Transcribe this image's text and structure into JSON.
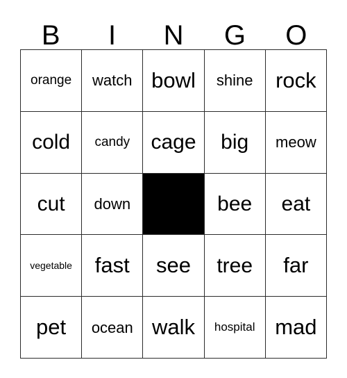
{
  "card": {
    "title": "BINGO",
    "header_letters": [
      "B",
      "I",
      "N",
      "G",
      "O"
    ],
    "free_space": {
      "row": 3,
      "column": 3,
      "color": "#000000",
      "label": ""
    },
    "colors": {
      "background": "#ffffff",
      "grid_line": "#2b2b2b",
      "text": "#000000",
      "free_space": "#000000"
    },
    "rows": [
      [
        {
          "word": "orange",
          "size": "sm"
        },
        {
          "word": "watch",
          "size": "md"
        },
        {
          "word": "bowl",
          "size": "xl"
        },
        {
          "word": "shine",
          "size": "md"
        },
        {
          "word": "rock",
          "size": "xl"
        }
      ],
      [
        {
          "word": "cold",
          "size": "lg"
        },
        {
          "word": "candy",
          "size": "sm"
        },
        {
          "word": "cage",
          "size": "lg"
        },
        {
          "word": "big",
          "size": "lg"
        },
        {
          "word": "meow",
          "size": "md"
        }
      ],
      [
        {
          "word": "cut",
          "size": "lg"
        },
        {
          "word": "down",
          "size": "md"
        },
        {
          "word": "",
          "size": "lg",
          "free": true
        },
        {
          "word": "bee",
          "size": "lg"
        },
        {
          "word": "eat",
          "size": "lg"
        }
      ],
      [
        {
          "word": "vegetable",
          "size": "xxs"
        },
        {
          "word": "fast",
          "size": "xl"
        },
        {
          "word": "see",
          "size": "xl"
        },
        {
          "word": "tree",
          "size": "lg"
        },
        {
          "word": "far",
          "size": "xl"
        }
      ],
      [
        {
          "word": "pet",
          "size": "xl"
        },
        {
          "word": "ocean",
          "size": "md"
        },
        {
          "word": "walk",
          "size": "xl"
        },
        {
          "word": "hospital",
          "size": "xs"
        },
        {
          "word": "mad",
          "size": "xl"
        }
      ]
    ]
  }
}
